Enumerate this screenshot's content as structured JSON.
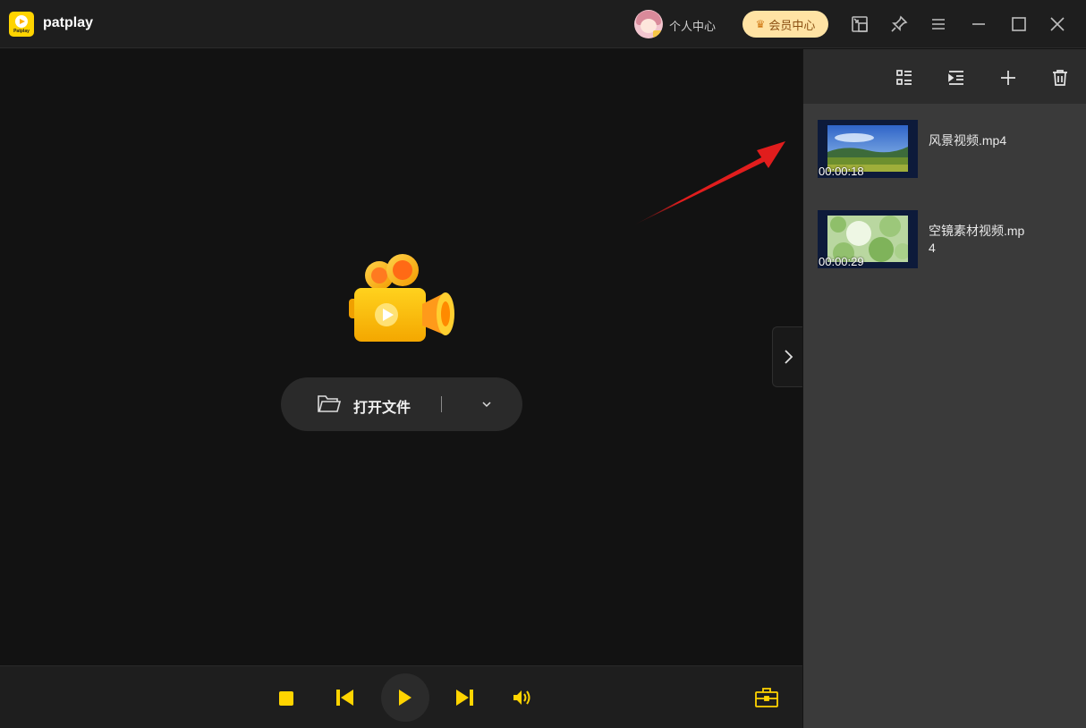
{
  "app": {
    "name": "patplay",
    "logo_text": "Patplay"
  },
  "header": {
    "personal_center": "个人中心",
    "vip_center": "会员中心"
  },
  "main": {
    "open_file_label": "打开文件"
  },
  "playlist": {
    "items": [
      {
        "name": "风景视频.mp4",
        "duration": "00:00:18"
      },
      {
        "name": "空镜素材视频.mp4",
        "duration": "00:00:29"
      }
    ]
  },
  "colors": {
    "accent": "#ffd400",
    "panel_bg": "#3a3a3a",
    "video_bg": "#121212",
    "annotation_arrow": "#e11d1d"
  }
}
